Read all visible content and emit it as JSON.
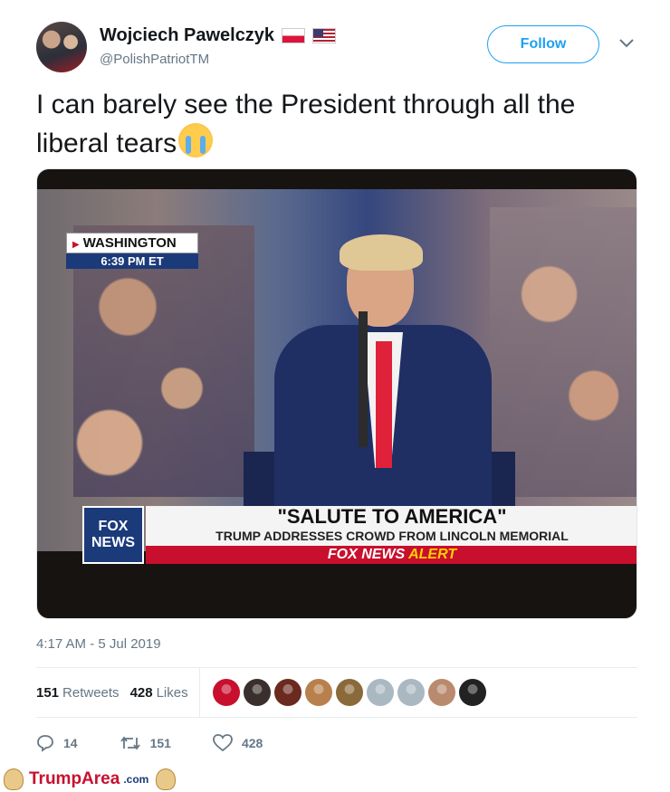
{
  "user": {
    "display_name": "Wojciech Pawelczyk",
    "handle": "@PolishPatriotTM",
    "flags": [
      "flag-poland-icon",
      "flag-usa-icon"
    ]
  },
  "follow_label": "Follow",
  "tweet": {
    "text": "I can barely see the President through all the liberal tears",
    "emoji": "loudly-crying-face"
  },
  "media": {
    "location": "WASHINGTON",
    "time": "6:39 PM ET",
    "channel_logo": "FOX NEWS",
    "headline": "\"SALUTE TO AMERICA\"",
    "subheadline": "TRUMP ADDRESSES CROWD FROM LINCOLN MEMORIAL",
    "alert_brand": "FOX NEWS",
    "alert_word": "ALERT"
  },
  "timestamp": "4:17 AM - 5 Jul 2019",
  "stats": {
    "retweets_count": "151",
    "retweets_label": "Retweets",
    "likes_count": "428",
    "likes_label": "Likes"
  },
  "liker_avatar_colors": [
    "#c8102e",
    "#3a2f2c",
    "#6b2a1f",
    "#b8804c",
    "#8a6a3a",
    "#aab8c2",
    "#aab8c2",
    "#b98a6e",
    "#222222"
  ],
  "actions": {
    "reply_count": "14",
    "retweet_count": "151",
    "like_count": "428"
  },
  "watermark": {
    "brand": "TrumpArea",
    "suffix": ".com"
  },
  "colors": {
    "accent": "#1da1f2",
    "secondary_text": "#657786"
  }
}
